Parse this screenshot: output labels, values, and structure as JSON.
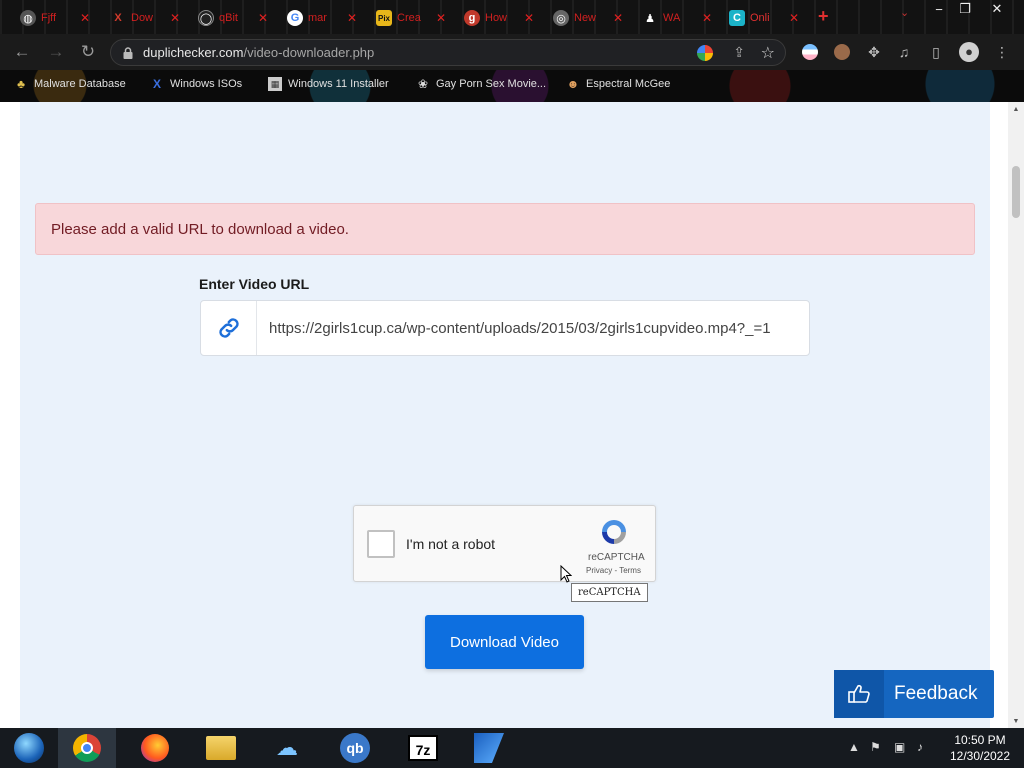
{
  "browser": {
    "tabs": [
      {
        "label": "Fjff",
        "favicon_color": "#888888"
      },
      {
        "label": "Dow",
        "favicon_color": "#d33b2c"
      },
      {
        "label": "qBit",
        "favicon_color": "#2a2a2a"
      },
      {
        "label": "mar",
        "favicon_color": "#ffffff"
      },
      {
        "label": "Crea",
        "favicon_color": "#e8b71a"
      },
      {
        "label": "How",
        "favicon_color": "#c0392b"
      },
      {
        "label": "New",
        "favicon_color": "#777777"
      },
      {
        "label": "WA",
        "favicon_color": "#ffffff"
      },
      {
        "label": "Onli",
        "favicon_color": "#1bb3c8"
      }
    ],
    "new_tab_symbol": "+",
    "window_controls": {
      "minimize": "−",
      "restore": "❐",
      "close": "✕"
    },
    "address": {
      "host": "duplichecker.com",
      "path": "/video-downloader.php"
    },
    "bookmarks": [
      {
        "label": "Malware Database",
        "icon_color": "#e0c050"
      },
      {
        "label": "Windows ISOs",
        "icon_color": "#3b6fe0"
      },
      {
        "label": "Windows 11 Installer",
        "icon_color": "#cccccc"
      },
      {
        "label": "Gay Porn Sex Movie...",
        "icon_color": "#dddddd"
      },
      {
        "label": "Espectral McGee",
        "icon_color": "#e0a060"
      }
    ]
  },
  "page": {
    "alert_text": "Please add a valid URL to download a video.",
    "url_label": "Enter Video URL",
    "url_value": "https://2girls1cup.ca/wp-content/uploads/2015/03/2girls1cupvideo.mp4?_=1",
    "captcha": {
      "label": "I'm not a robot",
      "brand": "reCAPTCHA",
      "links": "Privacy - Terms",
      "tooltip": "reCAPTCHA"
    },
    "download_button": "Download Video",
    "feedback_button": "Feedback"
  },
  "taskbar": {
    "apps": [
      "Start",
      "Google Chrome",
      "Firefox",
      "File Explorer",
      "Network",
      "qBittorrent",
      "7-Zip",
      "Editor"
    ],
    "time": "10:50 PM",
    "date": "12/30/2022"
  },
  "colors": {
    "accent_blue": "#0d6fe0",
    "feedback_blue": "#1566c0",
    "alert_bg": "#f8d7da",
    "alert_text": "#721c24",
    "page_bg": "#eaf2fb"
  }
}
